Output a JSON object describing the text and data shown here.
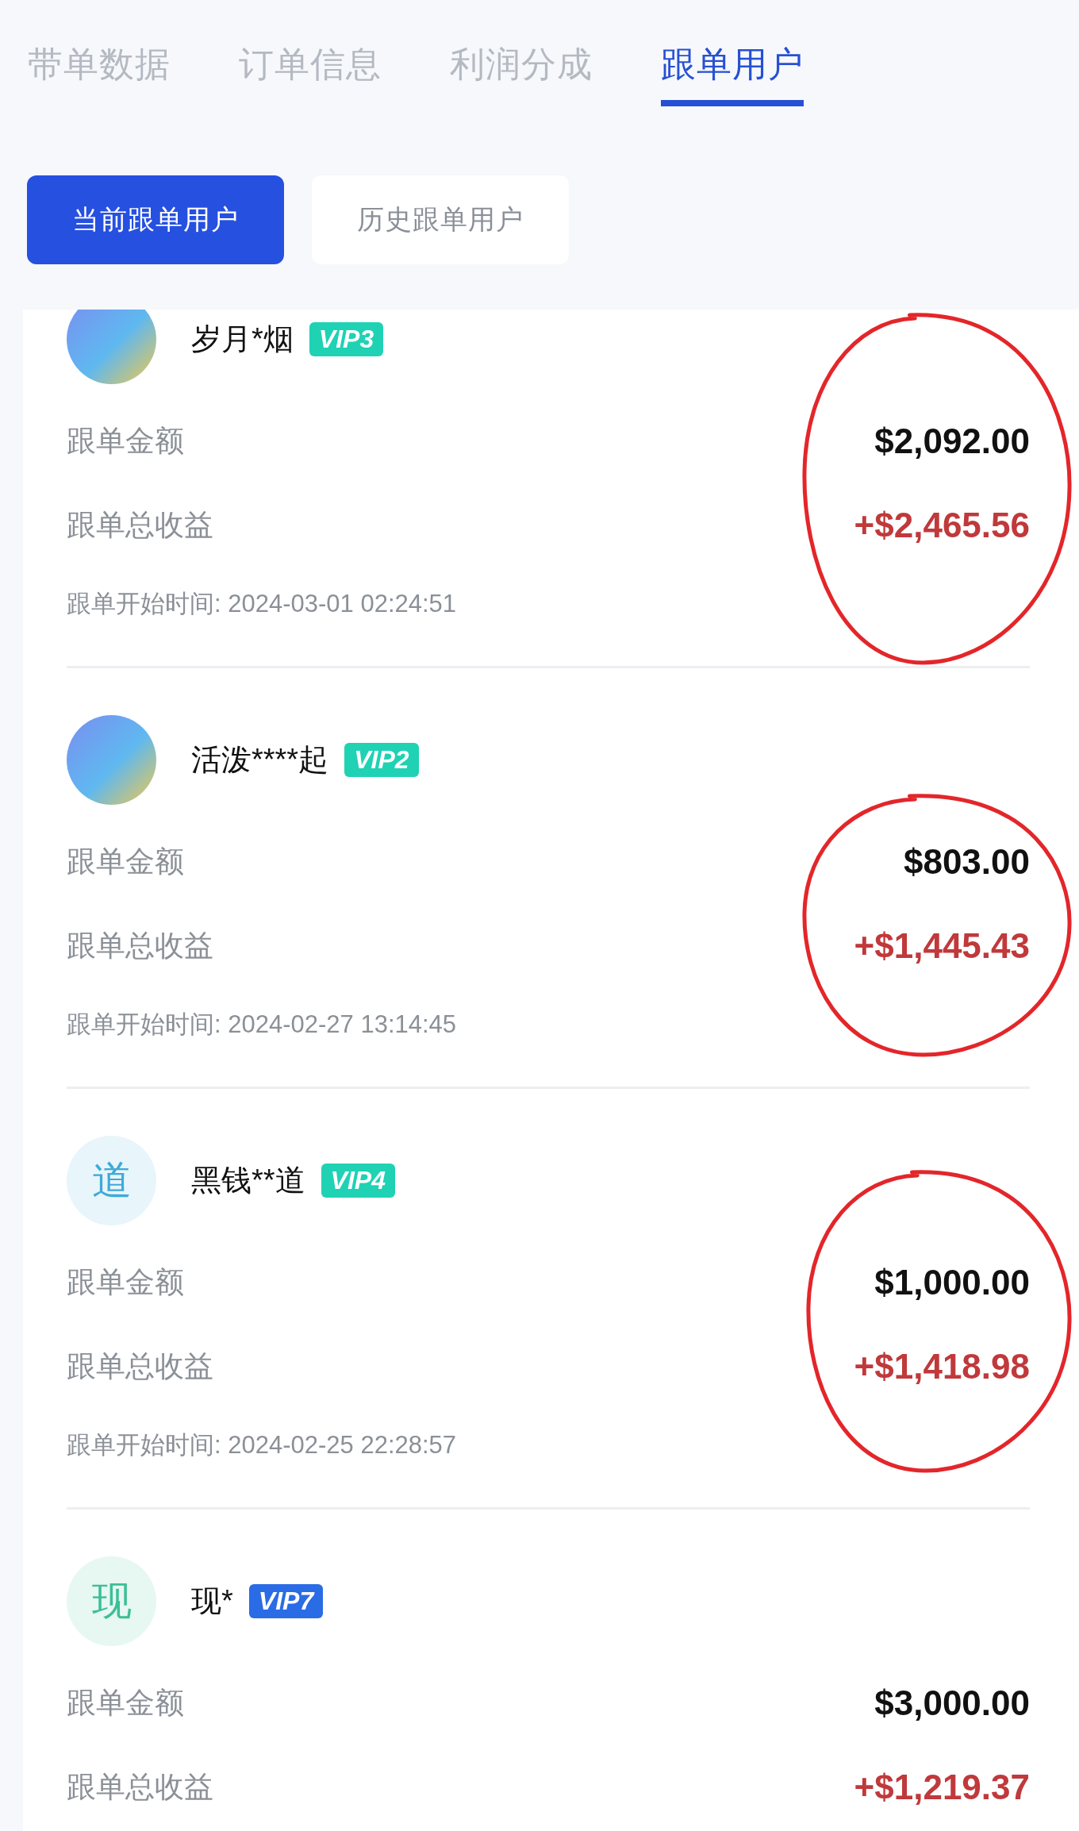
{
  "tabs": [
    {
      "label": "带单数据",
      "selected": false
    },
    {
      "label": "订单信息",
      "selected": false
    },
    {
      "label": "利润分成",
      "selected": false
    },
    {
      "label": "跟单用户",
      "selected": true
    }
  ],
  "segments": [
    {
      "label": "当前跟单用户",
      "selected": true
    },
    {
      "label": "历史跟单用户",
      "selected": false
    }
  ],
  "users": [
    {
      "avatar": {
        "kind": "image"
      },
      "name": "岁月*烟",
      "vip": {
        "label": "VIP3",
        "color": "#1fd2b4"
      },
      "amount_label": "跟单金额",
      "amount": "$2,092.00",
      "income_label": "跟单总收益",
      "income": "+$2,465.56",
      "start_time": "跟单开始时间: 2024-03-01 02:24:51",
      "circled": true
    },
    {
      "avatar": {
        "kind": "image"
      },
      "name": "活泼****起",
      "vip": {
        "label": "VIP2",
        "color": "#1fd2b4"
      },
      "amount_label": "跟单金额",
      "amount": "$803.00",
      "income_label": "跟单总收益",
      "income": "+$1,445.43",
      "start_time": "跟单开始时间: 2024-02-27 13:14:45",
      "circled": true
    },
    {
      "avatar": {
        "kind": "letter",
        "text": "道",
        "color": "#3fa9d9"
      },
      "name": "黑钱**道",
      "vip": {
        "label": "VIP4",
        "color": "#1fd2b4"
      },
      "amount_label": "跟单金额",
      "amount": "$1,000.00",
      "income_label": "跟单总收益",
      "income": "+$1,418.98",
      "start_time": "跟单开始时间: 2024-02-25 22:28:57",
      "circled": true
    },
    {
      "avatar": {
        "kind": "letter",
        "text": "现",
        "color": "#3cbf96"
      },
      "name": "现*",
      "vip": {
        "label": "VIP7",
        "color": "#2a6be6"
      },
      "amount_label": "跟单金额",
      "amount": "$3,000.00",
      "income_label": "跟单总收益",
      "income": "+$1,219.37",
      "circled": false
    }
  ]
}
